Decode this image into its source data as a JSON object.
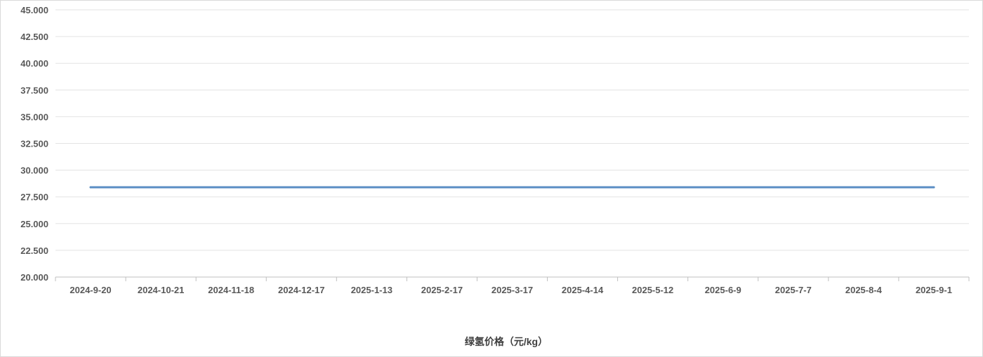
{
  "chart_data": {
    "type": "line",
    "title": "",
    "xlabel": "",
    "ylabel": "",
    "categories": [
      "2024-9-20",
      "2024-10-21",
      "2024-11-18",
      "2024-12-17",
      "2025-1-13",
      "2025-2-17",
      "2025-3-17",
      "2025-4-14",
      "2025-5-12",
      "2025-6-9",
      "2025-7-7",
      "2025-8-4",
      "2025-9-1"
    ],
    "yticks": [
      "20.000",
      "22.500",
      "25.000",
      "27.500",
      "30.000",
      "32.500",
      "35.000",
      "37.500",
      "40.000",
      "42.500",
      "45.000"
    ],
    "ylim": [
      20,
      45
    ],
    "grid": true,
    "legend_position": "bottom",
    "series": [
      {
        "name": "绿氢价格（元/kg）",
        "color": "#5b8ec4",
        "values": [
          28.4,
          28.4,
          28.4,
          28.4,
          28.4,
          28.4,
          28.4,
          28.4,
          28.4,
          28.4,
          28.4,
          28.4,
          28.4
        ]
      }
    ]
  }
}
